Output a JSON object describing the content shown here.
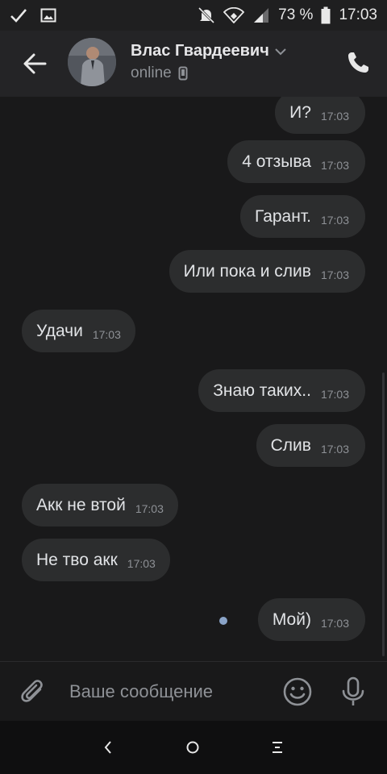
{
  "statusbar": {
    "battery": "73 %",
    "time": "17:03"
  },
  "header": {
    "name": "Влас Гвардеевич",
    "status": "online"
  },
  "messages": [
    {
      "side": "out",
      "text": "И?",
      "time": "17:03"
    },
    {
      "side": "out",
      "text": "4 отзыва",
      "time": "17:03"
    },
    {
      "side": "out",
      "text": "Гарант.",
      "time": "17:03"
    },
    {
      "side": "out",
      "text": "Или пока и слив",
      "time": "17:03"
    },
    {
      "side": "in",
      "text": "Удачи",
      "time": "17:03"
    },
    {
      "side": "out",
      "text": "Знаю таких..",
      "time": "17:03"
    },
    {
      "side": "out",
      "text": "Слив",
      "time": "17:03"
    },
    {
      "side": "in",
      "text": "Акк не втой",
      "time": "17:03"
    },
    {
      "side": "in",
      "text": "Не тво акк",
      "time": "17:03"
    },
    {
      "side": "out",
      "text": "Мой)",
      "time": "17:03",
      "unread": true
    }
  ],
  "composer": {
    "placeholder": "Ваше сообщение"
  },
  "icons": {
    "check": "check-icon",
    "image": "image-icon",
    "mute": "bell-off-icon",
    "wifi": "wifi-icon",
    "signal": "signal-icon",
    "battery": "battery-icon",
    "back": "arrow-back-icon",
    "phone": "phone-icon",
    "mobile": "mobile-icon",
    "attach": "paperclip-icon",
    "emoji": "smile-icon",
    "mic": "mic-icon"
  },
  "colors": {
    "background": "#19191a",
    "bubble": "#2c2d2e",
    "unread_dot": "#8aa4c8",
    "muted_text": "#8e9196"
  }
}
